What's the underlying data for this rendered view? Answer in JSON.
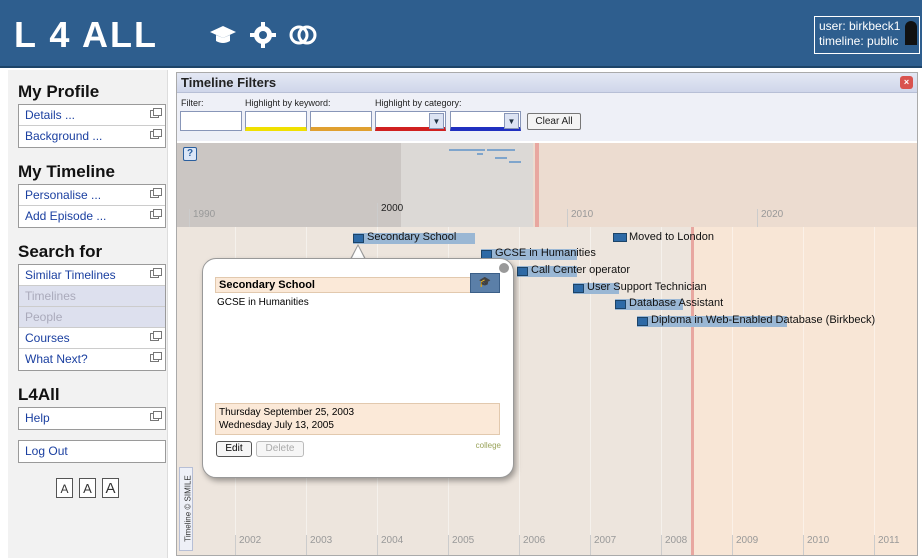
{
  "header": {
    "logo": "L 4 ALL",
    "user_line": "user: birkbeck1",
    "timeline_line": "timeline: public",
    "icons": [
      "graduation-cap-icon",
      "gear-icon",
      "link-rings-icon"
    ]
  },
  "sidebar": {
    "profile": {
      "title": "My Profile",
      "items": [
        "Details ...",
        "Background ..."
      ]
    },
    "timeline": {
      "title": "My Timeline",
      "items": [
        "Personalise ...",
        "Add Episode ..."
      ]
    },
    "search": {
      "title": "Search for",
      "items": [
        "Similar Timelines",
        "Timelines",
        "People",
        "Courses",
        "What Next?"
      ]
    },
    "l4all": {
      "title": "L4All",
      "items": [
        "Help"
      ]
    },
    "logout": "Log Out",
    "font_sizes": [
      "A",
      "A",
      "A"
    ]
  },
  "filters": {
    "title": "Timeline Filters",
    "filter_label": "Filter:",
    "keyword_label": "Highlight by keyword:",
    "category_label": "Highlight by category:",
    "clear_label": "Clear All",
    "highlight_colors": [
      "#f0e000",
      "#e0a030",
      "#d02020",
      "#2030c0"
    ]
  },
  "overview": {
    "decade_ticks": [
      "1990",
      "2000",
      "2010",
      "2020"
    ]
  },
  "timeline": {
    "year_ticks": [
      "2002",
      "2003",
      "2004",
      "2005",
      "2006",
      "2007",
      "2008",
      "2009",
      "2010",
      "2011"
    ],
    "events": [
      "Secondary School",
      "GCSE in Humanities",
      "Call Center operator",
      "User Support Technician",
      "Database Assistant",
      "Diploma in Web-Enabled Database (Birkbeck)",
      "Moved to London"
    ],
    "credit": "Timeline © SIMILE"
  },
  "popup": {
    "title": "Secondary School",
    "description": "GCSE in Humanities",
    "start_date": "Thursday September 25, 2003",
    "end_date": "Wednesday July 13, 2005",
    "edit_label": "Edit",
    "delete_label": "Delete",
    "category": "college"
  }
}
